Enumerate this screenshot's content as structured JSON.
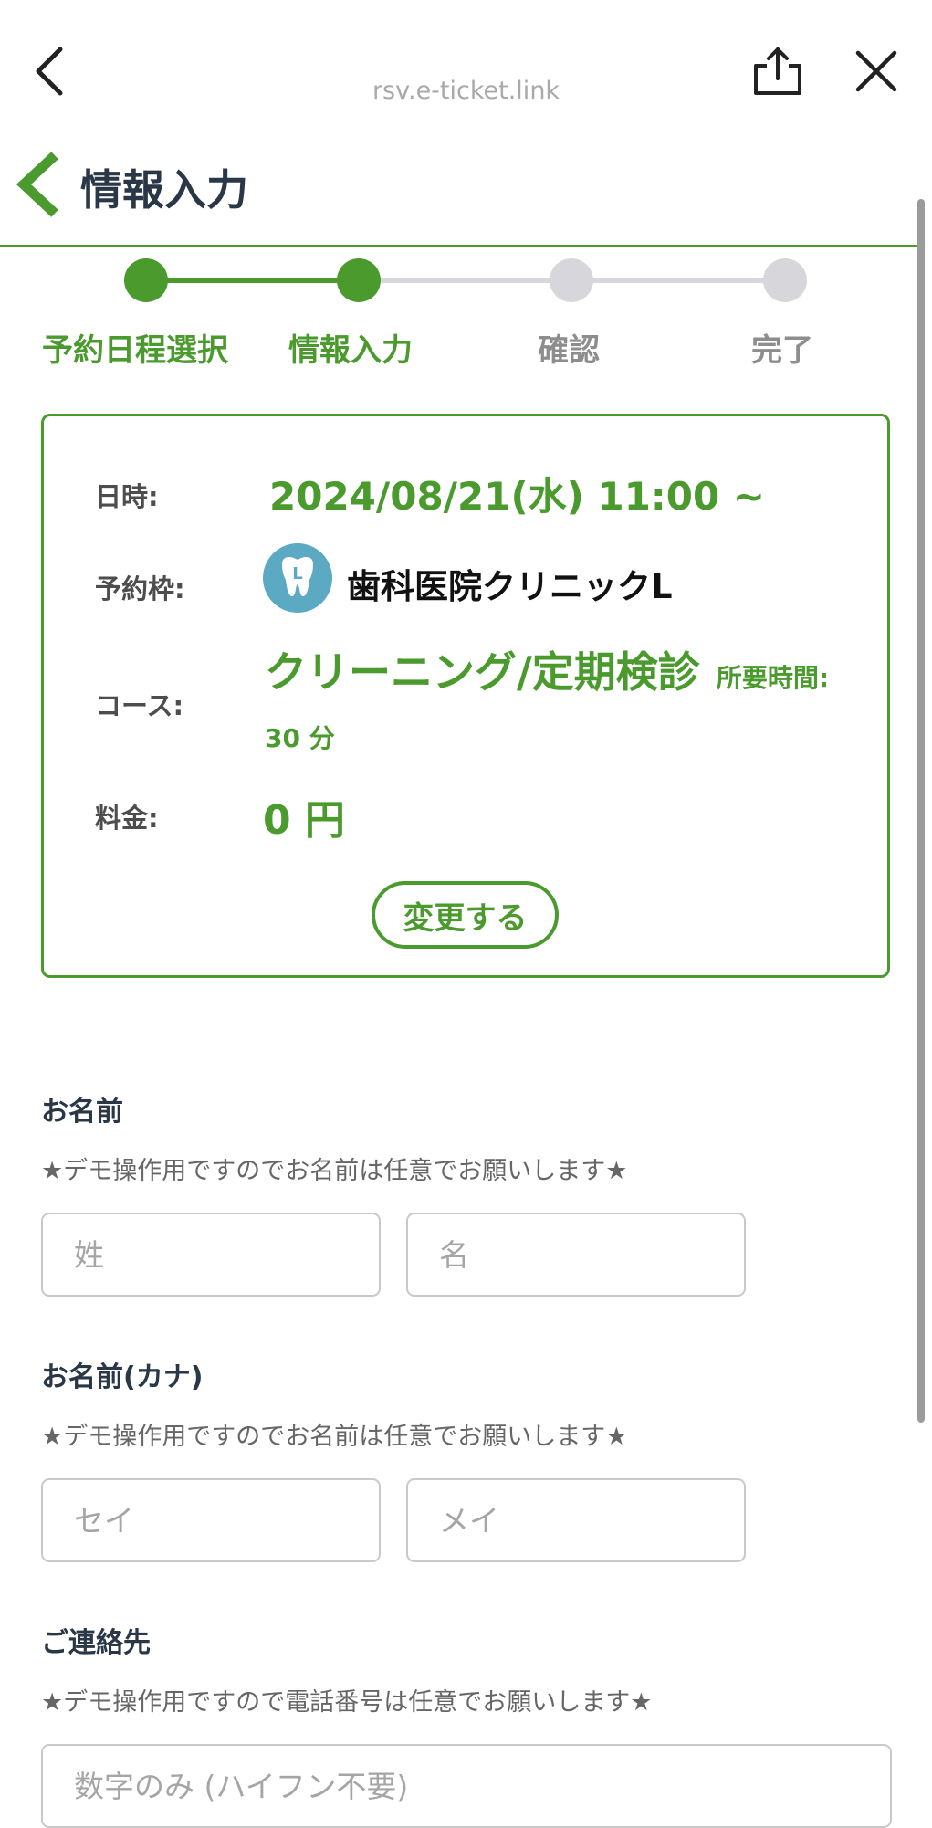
{
  "browser": {
    "url": "rsv.e-ticket.link",
    "icons": [
      "chevron-left-icon",
      "share-icon",
      "close-icon"
    ]
  },
  "header": {
    "title": "情報入力"
  },
  "stepper": {
    "steps": [
      {
        "label": "予約日程選択",
        "state": "done"
      },
      {
        "label": "情報入力",
        "state": "current"
      },
      {
        "label": "確認",
        "state": "pending"
      },
      {
        "label": "完了",
        "state": "pending"
      }
    ]
  },
  "summary": {
    "datetime_label": "日時:",
    "datetime_value": "2024/08/21(水) 11:00 ~",
    "slot_label": "予約枠:",
    "slot_logo_letter": "L",
    "slot_value": "歯科医院クリニックL",
    "course_label": "コース:",
    "course_value": "クリーニング/定期検診",
    "course_duration": "所要時間: 30 分",
    "price_label": "料金:",
    "price_value": "0 円",
    "change_button": "変更する"
  },
  "form": {
    "name": {
      "title": "お名前",
      "note": "★デモ操作用ですのでお名前は任意でお願いします★",
      "last_placeholder": "姓",
      "first_placeholder": "名"
    },
    "kana": {
      "title": "お名前(カナ)",
      "note": "★デモ操作用ですのでお名前は任意でお願いします★",
      "last_placeholder": "セイ",
      "first_placeholder": "メイ"
    },
    "contact": {
      "title": "ご連絡先",
      "note": "★デモ操作用ですので電話番号は任意でお願いします★",
      "phone_placeholder": "数字のみ (ハイフン不要)"
    }
  },
  "colors": {
    "accent": "#4a9a2e",
    "inactive": "#d7d7db",
    "heading": "#2a3746",
    "clinic_logo": "#5ba9c3"
  }
}
